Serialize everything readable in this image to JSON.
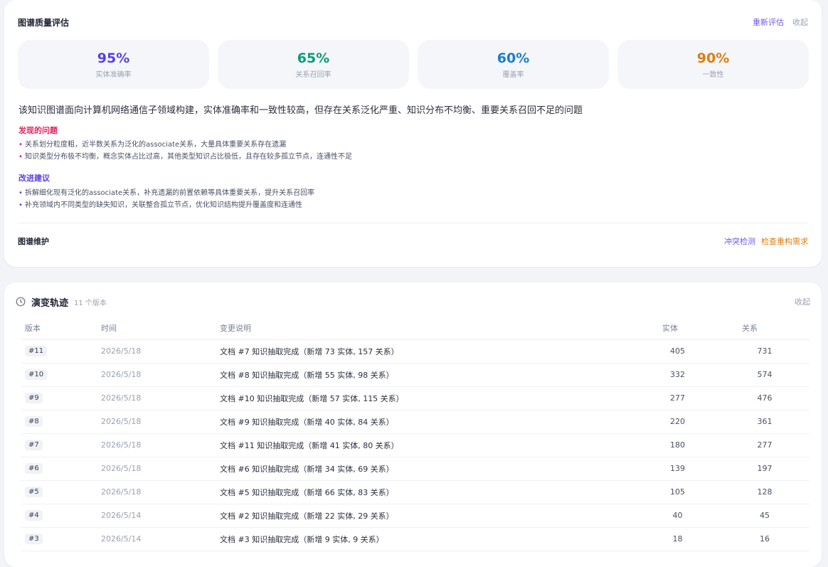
{
  "quality": {
    "title": "图谱质量评估",
    "reevaluate_label": "重新评估",
    "collapse_label": "收起",
    "metrics": [
      {
        "value": "95%",
        "label": "实体准确率",
        "color": "#5b3fe6"
      },
      {
        "value": "65%",
        "label": "关系召回率",
        "color": "#0f9b7a"
      },
      {
        "value": "60%",
        "label": "覆盖率",
        "color": "#1c7fc7"
      },
      {
        "value": "90%",
        "label": "一致性",
        "color": "#e07d10"
      }
    ],
    "summary": "该知识图谱面向计算机网络通信子领域构建，实体准确率和一致性较高，但存在关系泛化严重、知识分布不均衡、重要关系召回不足的问题",
    "problems_title": "发现的问题",
    "problems": [
      "关系划分粒度粗，近半数关系为泛化的associate关系，大量具体重要关系存在遗漏",
      "知识类型分布极不均衡，概念实体占比过高，其他类型知识占比极低，且存在较多孤立节点，连通性不足"
    ],
    "suggestions_title": "改进建议",
    "suggestions": [
      "拆解细化现有泛化的associate关系，补充遗漏的前置依赖等具体重要关系，提升关系召回率",
      "补充领域内不同类型的缺失知识，关联整合孤立节点，优化知识结构提升覆盖度和连通性"
    ],
    "maintenance_title": "图谱维护",
    "conflict_label": "冲突检测",
    "rebuild_label": "检查重构需求"
  },
  "history": {
    "title": "演变轨迹",
    "version_count": "11 个版本",
    "collapse_label": "收起",
    "columns": {
      "version": "版本",
      "time": "时间",
      "desc": "变更说明",
      "entities": "实体",
      "relations": "关系"
    },
    "rows": [
      {
        "version": "#11",
        "time": "2026/5/18",
        "desc": "文档 #7 知识抽取完成（新增 73 实体, 157 关系）",
        "entities": "405",
        "relations": "731"
      },
      {
        "version": "#10",
        "time": "2026/5/18",
        "desc": "文档 #8 知识抽取完成（新增 55 实体, 98 关系）",
        "entities": "332",
        "relations": "574"
      },
      {
        "version": "#9",
        "time": "2026/5/18",
        "desc": "文档 #10 知识抽取完成（新增 57 实体, 115 关系）",
        "entities": "277",
        "relations": "476"
      },
      {
        "version": "#8",
        "time": "2026/5/18",
        "desc": "文档 #9 知识抽取完成（新增 40 实体, 84 关系）",
        "entities": "220",
        "relations": "361"
      },
      {
        "version": "#7",
        "time": "2026/5/18",
        "desc": "文档 #11 知识抽取完成（新增 41 实体, 80 关系）",
        "entities": "180",
        "relations": "277"
      },
      {
        "version": "#6",
        "time": "2026/5/18",
        "desc": "文档 #6 知识抽取完成（新增 34 实体, 69 关系）",
        "entities": "139",
        "relations": "197"
      },
      {
        "version": "#5",
        "time": "2026/5/18",
        "desc": "文档 #5 知识抽取完成（新增 66 实体, 83 关系）",
        "entities": "105",
        "relations": "128"
      },
      {
        "version": "#4",
        "time": "2026/5/14",
        "desc": "文档 #2 知识抽取完成（新增 22 实体, 29 关系）",
        "entities": "40",
        "relations": "45"
      },
      {
        "version": "#3",
        "time": "2026/5/14",
        "desc": "文档 #3 知识抽取完成（新增 9 实体, 9 关系）",
        "entities": "18",
        "relations": "16"
      }
    ]
  }
}
